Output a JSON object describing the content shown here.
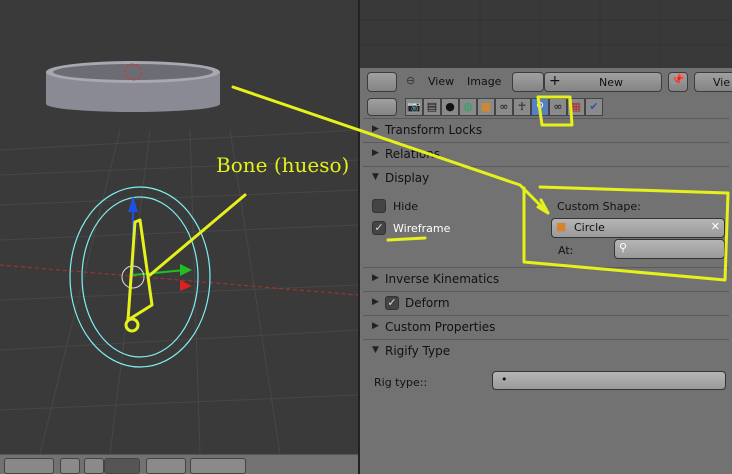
{
  "annotation": {
    "bone_label": "Bone (hueso)",
    "color": "#e6f01a"
  },
  "header": {
    "view": "View",
    "image": "Image",
    "new": "New",
    "view_trunc": "Vie"
  },
  "props_tabs": [
    "render-icon",
    "render-layers-icon",
    "scene-icon",
    "world-icon",
    "object-icon",
    "constraints-icon",
    "object-data-icon",
    "bone-icon",
    "bone-constraints-icon",
    "texture-icon",
    "physics-icon"
  ],
  "panels": {
    "transform_locks": "Transform Locks",
    "relations": "Relations",
    "display": "Display",
    "inverse_kinematics": "Inverse Kinematics",
    "deform": "Deform",
    "custom_properties": "Custom Properties",
    "rigify_type": "Rigify Type"
  },
  "display": {
    "hide": "Hide",
    "hide_checked": false,
    "wireframe": "Wireframe",
    "wireframe_checked": true,
    "custom_shape_label": "Custom Shape:",
    "custom_shape_value": "Circle",
    "at_label": "At:"
  },
  "deform_checked": true,
  "rigify": {
    "rig_type_label": "Rig type::",
    "rig_type_value": "•"
  },
  "colors": {
    "panel_bg": "#727272",
    "viewport_bg": "#3a3a3a",
    "active_tab": "#5680c2",
    "wire": "#7ef0f0"
  }
}
